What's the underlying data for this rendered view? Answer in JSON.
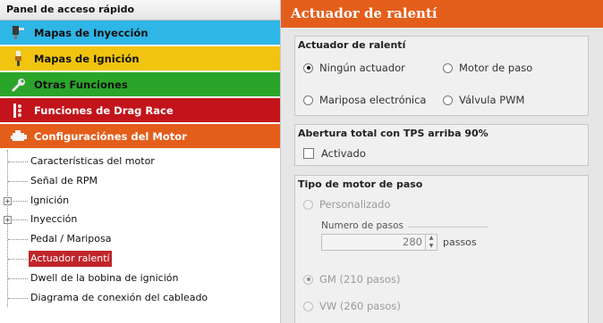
{
  "left_panel": {
    "title": "Panel de acceso rápido",
    "categories": [
      {
        "label": "Mapas de Inyección",
        "bg": "#2eb6e6",
        "fg": "#111111",
        "icon": "injector-icon"
      },
      {
        "label": "Mapas de Ignición",
        "bg": "#f1c40f",
        "fg": "#111111",
        "icon": "spark-plug-icon"
      },
      {
        "label": "Otras Funciones",
        "bg": "#2aa52a",
        "fg": "#111111",
        "icon": "wrench-icon"
      },
      {
        "label": "Funciones de Drag Race",
        "bg": "#c2141a",
        "fg": "#ffffff",
        "icon": "drag-race-icon"
      },
      {
        "label": "Configuraciónes del Motor",
        "bg": "#e45e1b",
        "fg": "#ffffff",
        "icon": "engine-icon"
      }
    ],
    "tree": [
      {
        "label": "Características del motor"
      },
      {
        "label": "Señal de RPM"
      },
      {
        "label": "Ignición",
        "expandable": true,
        "expand_glyph": "+"
      },
      {
        "label": "Inyección",
        "expandable": true,
        "expand_glyph": "+"
      },
      {
        "label": "Pedal / Mariposa"
      },
      {
        "label": "Actuador ralentí",
        "selected": true
      },
      {
        "label": "Dwell de la bobina de ignición"
      },
      {
        "label": "Diagrama de conexión del cableado"
      }
    ]
  },
  "right_panel": {
    "header": "Actuador de ralentí",
    "accent": "#e45e1b",
    "actuator_group": {
      "title": "Actuador de ralentí",
      "options": [
        {
          "label": "Ningún actuador",
          "checked": true
        },
        {
          "label": "Motor de paso",
          "checked": false
        },
        {
          "label": "Mariposa electrónica",
          "checked": false
        },
        {
          "label": "Válvula PWM",
          "checked": false
        }
      ]
    },
    "tps_group": {
      "title": "Abertura total con TPS arriba 90%",
      "checkbox_label": "Activado",
      "checked": false
    },
    "stepper_group": {
      "title": "Tipo de motor de paso",
      "custom_label": "Personalizado",
      "steps_label": "Numero de pasos",
      "steps_value": "280",
      "steps_unit": "passos",
      "spin_up": "▲",
      "spin_down": "▼",
      "gm_label": "GM (210 pasos)",
      "gm_checked": true,
      "vw_label": "VW (260 pasos)",
      "vw_checked": false
    }
  }
}
